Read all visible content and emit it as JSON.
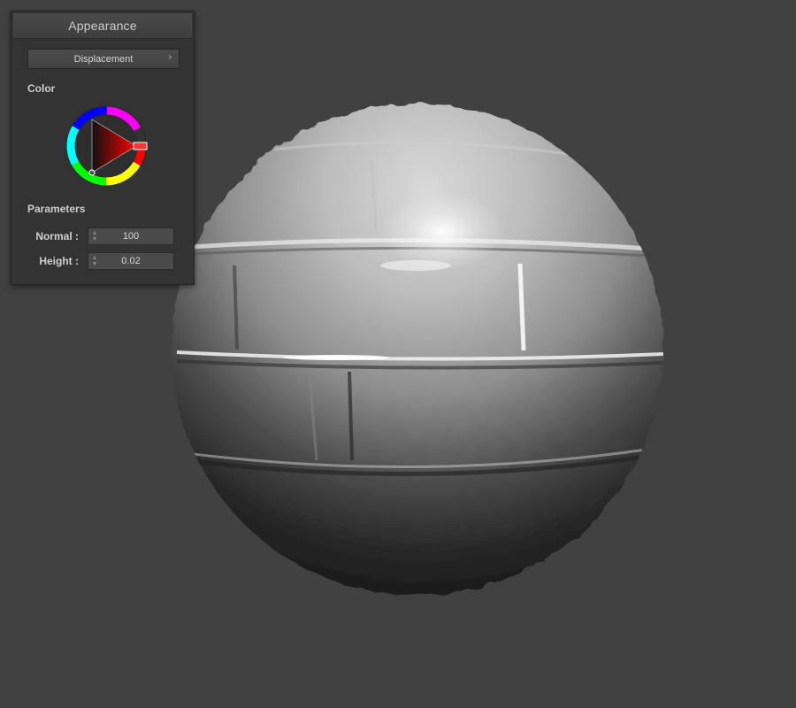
{
  "panel": {
    "title": "Appearance",
    "dropdown": {
      "value": "Displacement",
      "chevron_icon": "chevron-right-icon"
    },
    "color_section": {
      "label": "Color",
      "selected_hue": "#ff0000"
    },
    "parameters_section": {
      "label": "Parameters",
      "fields": [
        {
          "label": "Normal :",
          "value": "100"
        },
        {
          "label": "Height :",
          "value": "0.02"
        }
      ]
    }
  },
  "viewport": {
    "object": "sphere-preview",
    "background": "#414141"
  }
}
